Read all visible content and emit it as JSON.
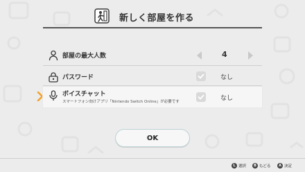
{
  "header": {
    "title": "新しく部屋を作る",
    "icon": "door-with-person-icon"
  },
  "settings": [
    {
      "label": "部屋の最大人数",
      "icon": "person-icon",
      "value": "4"
    },
    {
      "label": "パスワード",
      "icon": "lock-icon",
      "checked": false,
      "status": "なし"
    },
    {
      "label": "ボイスチャット",
      "icon": "microphone-icon",
      "sublabel": "スマートフォン向けアプリ「Nintendo Switch Online」が必要です",
      "checked": false,
      "status": "なし"
    }
  ],
  "ok_button": {
    "label": "OK"
  },
  "footer_hints": [
    {
      "button": "L",
      "label": "選択"
    },
    {
      "button": "B",
      "label": "もどる"
    },
    {
      "button": "A",
      "label": "決定"
    }
  ],
  "colors": {
    "background": "#ececec",
    "cursor": "#f2a12a",
    "button_border": "#bcd3d6"
  }
}
